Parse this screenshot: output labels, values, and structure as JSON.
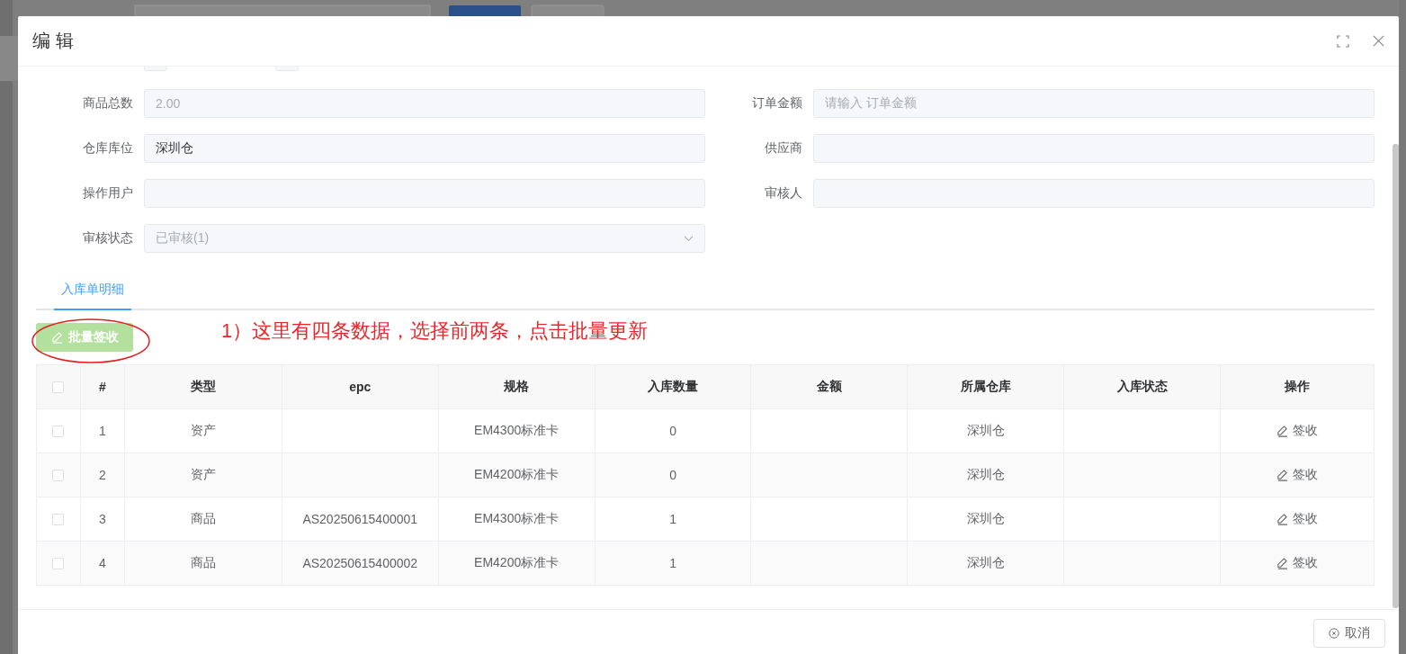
{
  "dialog": {
    "title": "编 辑"
  },
  "form": [
    {
      "label": "商品总数",
      "kind": "input",
      "value": "2.00",
      "disabled": true
    },
    {
      "label": "订单金额",
      "kind": "input",
      "placeholder": "请输入 订单金额"
    },
    {
      "label": "仓库库位",
      "kind": "input",
      "value": "深圳仓",
      "disabled": false
    },
    {
      "label": "供应商",
      "kind": "input"
    },
    {
      "label": "操作用户",
      "kind": "input"
    },
    {
      "label": "审核人",
      "kind": "input"
    },
    {
      "label": "审核状态",
      "kind": "select",
      "value": "已审核(1)",
      "disabled": true
    }
  ],
  "tabs": [
    {
      "label": "入库单明细",
      "selected": true
    }
  ],
  "batch_button": {
    "label": "批量签收",
    "disabled": true
  },
  "annotation": {
    "text": "1）这里有四条数据，选择前两条，点击批量更新"
  },
  "table": {
    "columns": [
      "#",
      "类型",
      "epc",
      "规格",
      "入库数量",
      "金额",
      "所属仓库",
      "入库状态",
      "操作"
    ],
    "header_checked": false,
    "rows": [
      {
        "checked": false,
        "cells": [
          "1",
          "资产",
          "",
          "EM4300标准卡",
          "0",
          "",
          "深圳仓",
          ""
        ],
        "action": "签收"
      },
      {
        "checked": false,
        "cells": [
          "2",
          "资产",
          "",
          "EM4200标准卡",
          "0",
          "",
          "深圳仓",
          ""
        ],
        "action": "签收"
      },
      {
        "checked": false,
        "cells": [
          "3",
          "商品",
          "AS20250615400001",
          "EM4300标准卡",
          "1",
          "",
          "深圳仓",
          ""
        ],
        "action": "签收"
      },
      {
        "checked": false,
        "cells": [
          "4",
          "商品",
          "AS20250615400002",
          "EM4200标准卡",
          "1",
          "",
          "深圳仓",
          ""
        ],
        "action": "签收"
      }
    ]
  },
  "footer": {
    "cancel": "取消"
  }
}
